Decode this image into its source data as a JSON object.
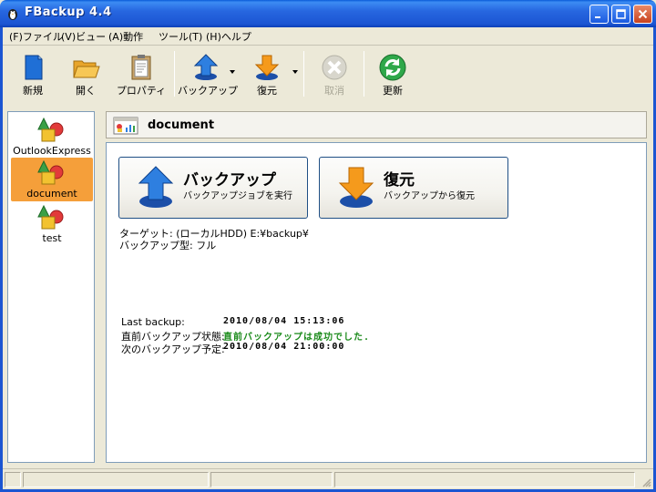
{
  "window": {
    "title": "FBackup   4.4"
  },
  "menu": [
    {
      "label": "(F)ファイル"
    },
    {
      "label": "(V)ビュー"
    },
    {
      "label": "(A)動作"
    },
    {
      "label": "ツール(T)"
    },
    {
      "label": "(H)ヘルプ"
    }
  ],
  "toolbar": {
    "new_label": "新規",
    "open_label": "開く",
    "properties_label": "プロパティ",
    "backup_label": "バックアップ",
    "restore_label": "復元",
    "cancel_label": "取消",
    "refresh_label": "更新"
  },
  "jobs": [
    {
      "label": "OutlookExpress",
      "selected": false
    },
    {
      "label": "document",
      "selected": true
    },
    {
      "label": "test",
      "selected": false
    }
  ],
  "header": {
    "title": "document"
  },
  "actions": {
    "backup": {
      "title": "バックアップ",
      "subtitle": "バックアップジョブを実行"
    },
    "restore": {
      "title": "復元",
      "subtitle": "バックアップから復元"
    }
  },
  "info": {
    "target": "ターゲット: (ローカルHDD) E:¥backup¥",
    "backup_type": "バックアップ型: フル"
  },
  "status": {
    "last_backup_label": "Last backup:",
    "last_backup_value": "2010/08/04 15:13:06",
    "last_status_label": "直前バックアップ状態:",
    "last_status_value": "直前バックアップは成功でした.",
    "next_backup_label": "次のバックアップ予定:",
    "next_backup_value": "2010/08/04 21:00:00"
  },
  "colors": {
    "title_bar": "#2767e0",
    "selection": "#f59f3a",
    "success_text": "#1a8a1a",
    "panel_border": "#7f9db9"
  }
}
